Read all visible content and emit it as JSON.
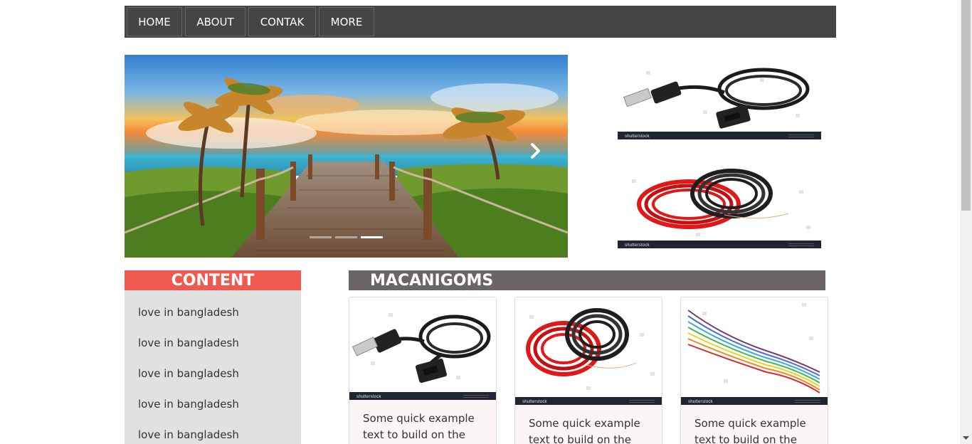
{
  "nav": {
    "items": [
      {
        "label": "HOME"
      },
      {
        "label": "ABOUT"
      },
      {
        "label": "CONTAK"
      },
      {
        "label": "MORE"
      }
    ]
  },
  "hero": {
    "image": "beach boardwalk with palm trees at sunset",
    "next_icon": "chevron-right-icon",
    "slide_count": 3,
    "active_slide": 3
  },
  "side_images": [
    {
      "image": "black usb extension cable",
      "watermark": "shutterstock"
    },
    {
      "image": "red and black cable coils",
      "watermark": "shutterstock"
    }
  ],
  "content_section": {
    "title": "CONTENT",
    "items": [
      "love in bangladesh",
      "love in bangladesh",
      "love in bangladesh",
      "love in bangladesh",
      "love in bangladesh"
    ]
  },
  "products_section": {
    "title": "MACANIGOMS",
    "cards": [
      {
        "image": "black usb extension cable",
        "watermark": "shutterstock",
        "text": "Some quick example text to build on the"
      },
      {
        "image": "red and black cable coils",
        "watermark": "shutterstock",
        "text": "Some quick example text to build on the"
      },
      {
        "image": "multicolor ribbon wires",
        "watermark": "shutterstock",
        "text": "Some quick example text to build on the"
      }
    ]
  },
  "colors": {
    "nav_bg": "#454545",
    "content_header": "#f0594f",
    "content_bg": "#e2e1e0",
    "products_header": "#6b6565"
  }
}
